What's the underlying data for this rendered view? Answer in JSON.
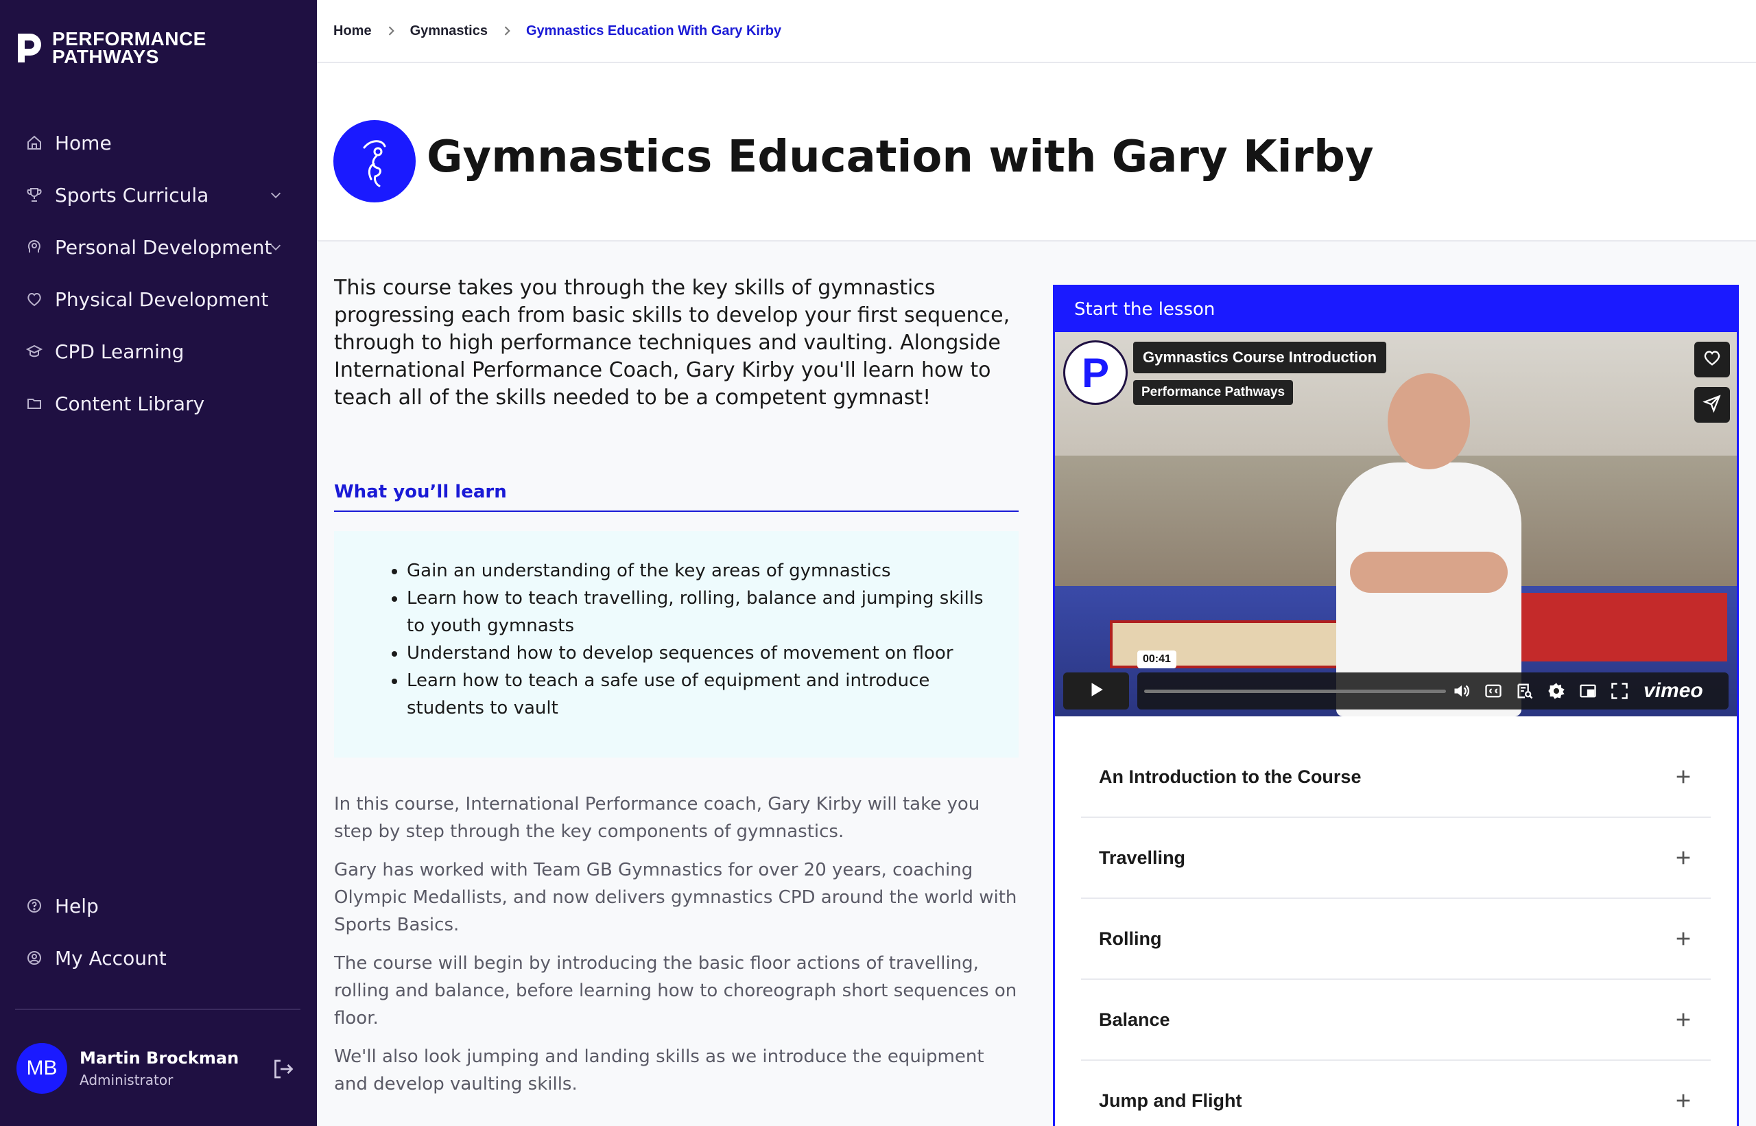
{
  "app": {
    "logo_line1": "PERFORMANCE",
    "logo_line2": "PATHWAYS"
  },
  "sidebar": {
    "items": [
      {
        "label": "Home",
        "icon": "home-icon",
        "has_chevron": false
      },
      {
        "label": "Sports Curricula",
        "icon": "trophy-icon",
        "has_chevron": true
      },
      {
        "label": "Personal Development",
        "icon": "head-icon",
        "has_chevron": true
      },
      {
        "label": "Physical Development",
        "icon": "heart-shield-icon",
        "has_chevron": false
      },
      {
        "label": "CPD Learning",
        "icon": "graduation-cap-icon",
        "has_chevron": false
      },
      {
        "label": "Content Library",
        "icon": "folder-icon",
        "has_chevron": false
      }
    ],
    "bottom_items": [
      {
        "label": "Help",
        "icon": "help-icon"
      },
      {
        "label": "My Account",
        "icon": "account-icon"
      }
    ],
    "user": {
      "initials": "MB",
      "name": "Martin Brockman",
      "role": "Administrator"
    }
  },
  "breadcrumb": [
    "Home",
    "Gymnastics",
    "Gymnastics Education With Gary Kirby"
  ],
  "page": {
    "title": "Gymnastics Education with Gary Kirby",
    "intro": "This course takes you through the key skills of gymnastics progressing each from basic skills to develop your first sequence, through to high performance techniques and vaulting. Alongside International Performance Coach, Gary Kirby you'll learn how to teach all of the skills needed to be a competent gymnast!",
    "learn_heading": "What you’ll learn",
    "learn_items": [
      "Gain an understanding of the key areas of gymnastics",
      "Learn how to teach travelling, rolling, balance and jumping skills to youth gymnasts",
      "Understand how to develop sequences of movement on floor",
      "Learn how to teach a safe use of equipment and introduce students to vault"
    ],
    "paragraphs": [
      "In this course, International Performance coach, Gary Kirby will take you step by step through the key components of gymnastics.",
      "Gary has worked with Team GB Gymnastics for over 20 years, coaching Olympic Medallists, and now delivers gymnastics CPD around the world with Sports Basics.",
      "The course will begin by introducing the basic floor actions of travelling, rolling and balance, before learning how to choreograph short sequences on floor.",
      "We'll also look jumping and landing skills as we introduce the equipment and develop vaulting skills."
    ]
  },
  "lesson_panel": {
    "header": "Start the lesson",
    "video": {
      "title": "Gymnastics Course Introduction",
      "channel": "Performance Pathways",
      "logo_letter": "P",
      "time": "00:41",
      "player_brand": "vimeo"
    },
    "sections": [
      "An Introduction to the Course",
      "Travelling",
      "Rolling",
      "Balance",
      "Jump and Flight"
    ]
  },
  "colors": {
    "sidebar_bg": "#1f1042",
    "accent": "#1a1aff",
    "link": "#1a1ad6"
  }
}
